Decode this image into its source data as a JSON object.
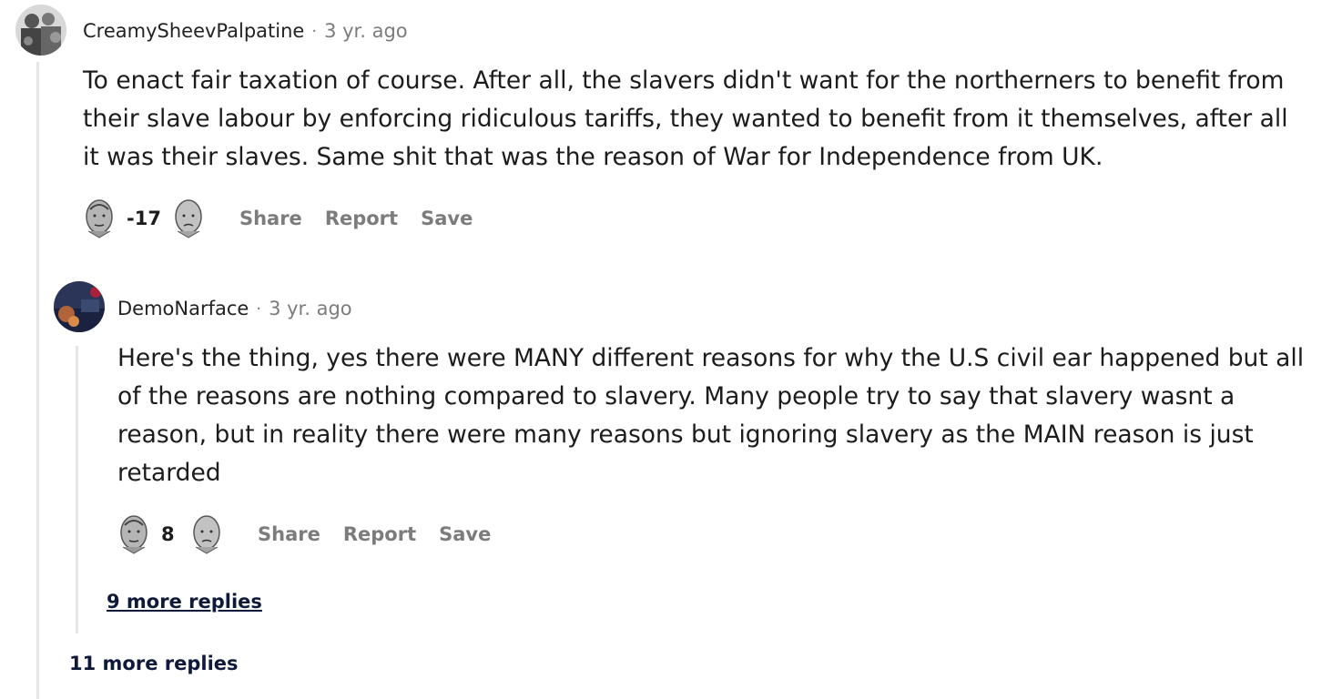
{
  "comments": [
    {
      "author": "CreamySheevPalpatine",
      "separator": "·",
      "time": "3 yr. ago",
      "lines": [
        "To enact fair taxation of course. After all, the slavers didn't want for the northerners to benefit from",
        "their slave labour by enforcing ridiculous tariffs, they wanted to benefit from it themselves, after all",
        "it was their slaves. Same shit that was the reason of War for Independence from UK."
      ],
      "score": "-17",
      "actions": {
        "share": "Share",
        "report": "Report",
        "save": "Save"
      }
    },
    {
      "author": "DemoNarface",
      "separator": "·",
      "time": "3 yr. ago",
      "lines": [
        "Here's the thing, yes there were MANY different reasons for why the U.S civil ear happened but all",
        "of the reasons are nothing compared to slavery. Many people try to say that slavery wasnt a",
        "reason, but in reality there were many reasons but ignoring slavery as the MAIN reason is just",
        "retarded"
      ],
      "score": "8",
      "actions": {
        "share": "Share",
        "report": "Report",
        "save": "Save"
      },
      "more_replies": "9 more replies"
    }
  ],
  "outer_more_replies": "11 more replies",
  "icons": {
    "upvote": "upvote-bust-icon",
    "downvote": "downvote-bust-icon"
  }
}
